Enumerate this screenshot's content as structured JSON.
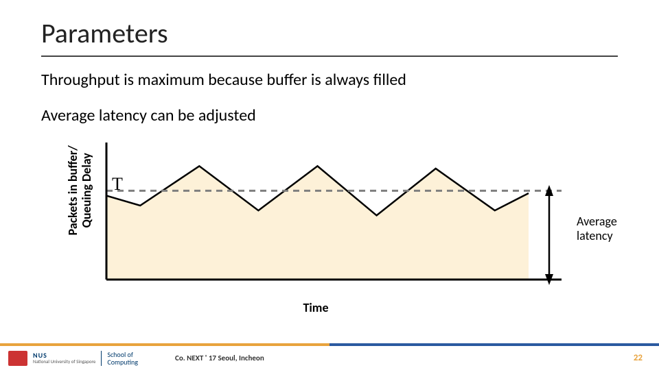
{
  "title": "Parameters",
  "body": {
    "line1": "Throughput is maximum because buffer is always filled",
    "line2": "Average latency can be adjusted"
  },
  "chart_data": {
    "type": "line",
    "title": "",
    "ylabel_line1": "Packets in buffer/",
    "ylabel_line2": "Queuing Delay",
    "xlabel": "Time",
    "threshold_label": "T",
    "threshold_y": 0.72,
    "x": [
      0.0,
      0.08,
      0.22,
      0.36,
      0.5,
      0.64,
      0.78,
      0.92,
      1.0
    ],
    "y": [
      0.68,
      0.6,
      0.92,
      0.56,
      0.92,
      0.52,
      0.9,
      0.56,
      0.7
    ],
    "ylim": [
      0,
      1
    ],
    "annotation": {
      "label_line1": "Average",
      "label_line2": "latency"
    },
    "colors": {
      "fill": "#fdf1d8",
      "stroke": "#000000",
      "dash": "#7f7f7f",
      "arrow": "#000000"
    }
  },
  "footer": {
    "org_abbr": "NUS",
    "org_full": "National University of Singapore",
    "school_l1": "School of",
    "school_l2": "Computing",
    "conference": "Co. NEXT ' 17 Seoul, Incheon",
    "page": "22"
  }
}
